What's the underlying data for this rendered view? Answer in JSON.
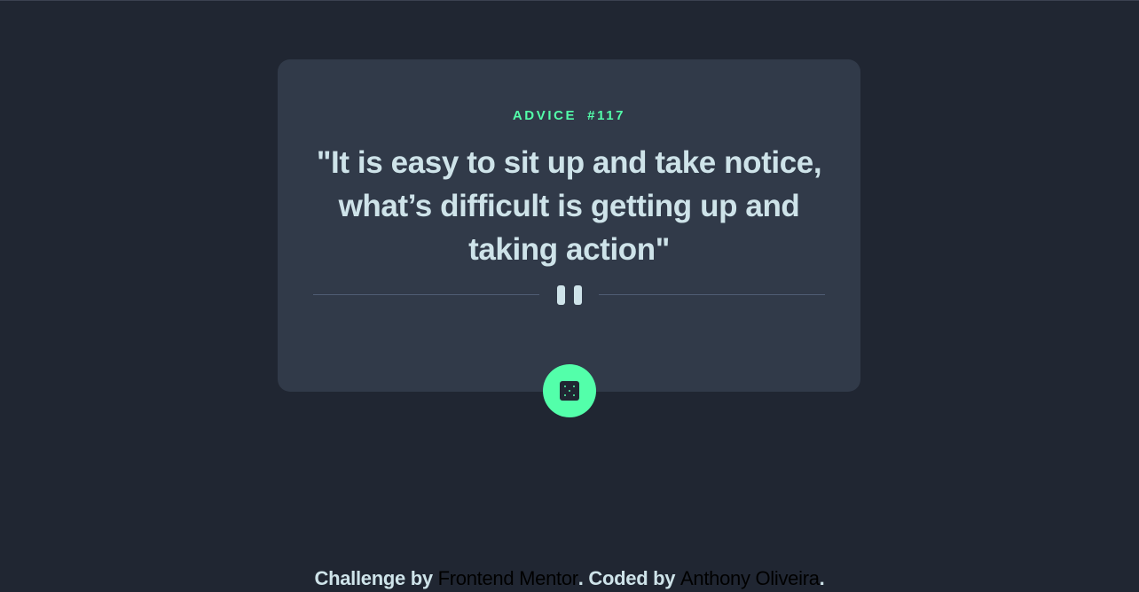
{
  "card": {
    "advice_label": "ADVICE",
    "advice_number": "#117",
    "quote": "\"It is easy to sit up and take notice, what’s difficult is getting up and taking action\""
  },
  "icons": {
    "divider": "pause-icon",
    "button": "dice-icon"
  },
  "footer": {
    "prefix": "Challenge by ",
    "challenge_link": "Frontend Mentor",
    "middle": ". Coded by ",
    "author_link": "Anthony Oliveira",
    "suffix": "."
  },
  "colors": {
    "background": "#202632",
    "card": "#313a49",
    "accent": "#53ffaa",
    "text": "#cee3e9",
    "divider": "#4f5d74"
  }
}
